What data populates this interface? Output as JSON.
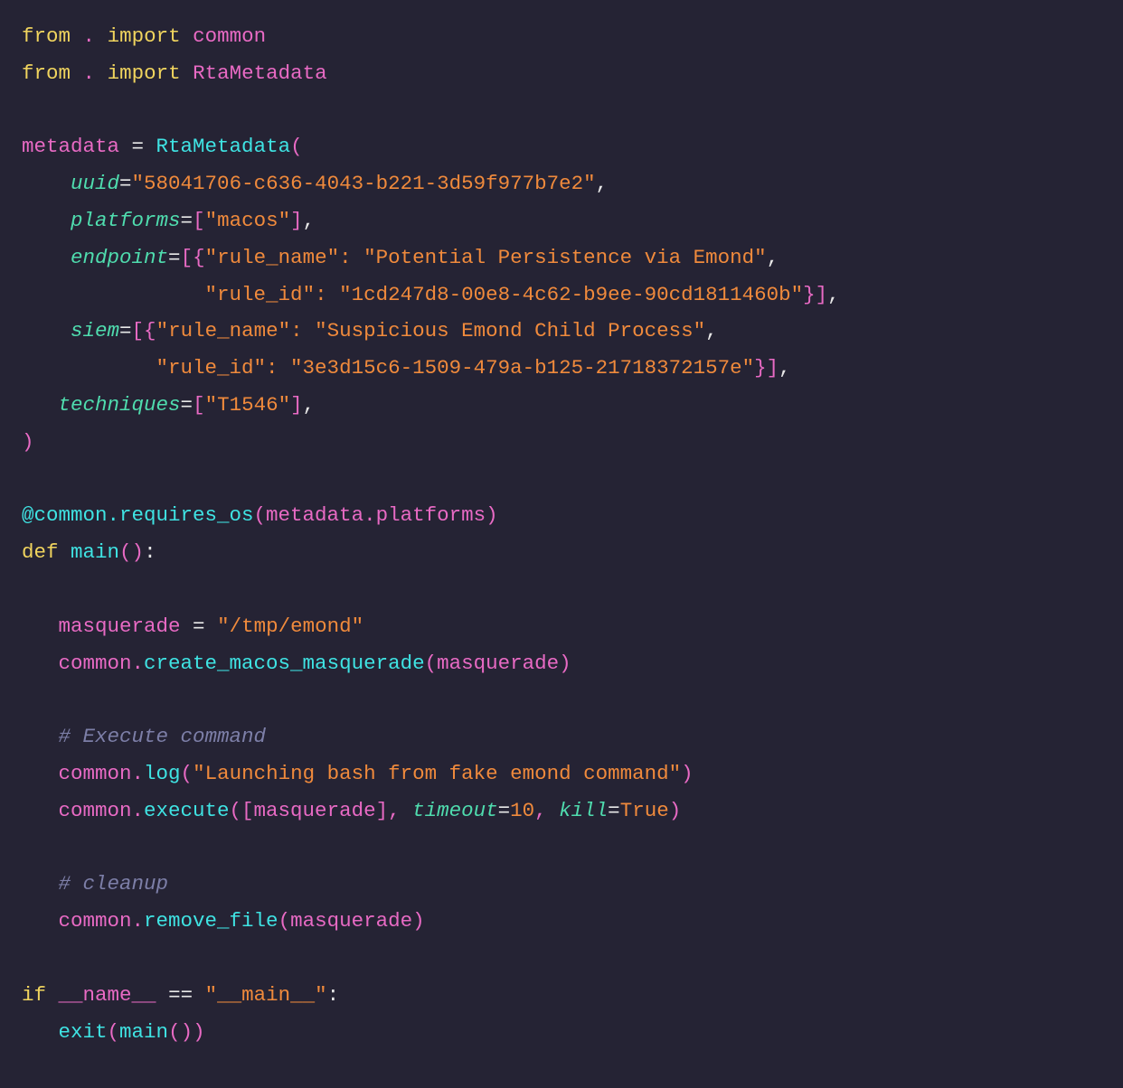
{
  "editor": {
    "language": "python",
    "colors": {
      "background": "#252334",
      "keyword": "#f0d45e",
      "identifier": "#e86ac4",
      "function": "#3fe3e3",
      "string": "#f08a3c",
      "kwarg": "#4fdcae",
      "comment": "#7d7fa8"
    },
    "lines": [
      [
        [
          "kw",
          "from"
        ],
        [
          "wh",
          " "
        ],
        [
          "pk",
          "."
        ],
        [
          "wh",
          " "
        ],
        [
          "kw",
          "import"
        ],
        [
          "wh",
          " "
        ],
        [
          "pk",
          "common"
        ]
      ],
      [
        [
          "kw",
          "from"
        ],
        [
          "wh",
          " "
        ],
        [
          "pk",
          "."
        ],
        [
          "wh",
          " "
        ],
        [
          "kw",
          "import"
        ],
        [
          "wh",
          " "
        ],
        [
          "pk",
          "RtaMetadata"
        ]
      ],
      [],
      [
        [
          "pk",
          "metadata"
        ],
        [
          "wh",
          " = "
        ],
        [
          "cy",
          "RtaMetadata"
        ],
        [
          "pk",
          "("
        ]
      ],
      [
        [
          "wh",
          "    "
        ],
        [
          "gr",
          "uuid"
        ],
        [
          "wh",
          "="
        ],
        [
          "or",
          "\"58041706-c636-4043-b221-3d59f977b7e2\""
        ],
        [
          "wh",
          ","
        ]
      ],
      [
        [
          "wh",
          "    "
        ],
        [
          "gr",
          "platforms"
        ],
        [
          "wh",
          "="
        ],
        [
          "pk",
          "["
        ],
        [
          "or",
          "\"macos\""
        ],
        [
          "pk",
          "]"
        ],
        [
          "wh",
          ","
        ]
      ],
      [
        [
          "wh",
          "    "
        ],
        [
          "gr",
          "endpoint"
        ],
        [
          "wh",
          "="
        ],
        [
          "pk",
          "[{"
        ],
        [
          "or",
          "\"rule_name\": \"Potential Persistence via Emond\""
        ],
        [
          "wh",
          ","
        ]
      ],
      [
        [
          "wh",
          "               "
        ],
        [
          "or",
          "\"rule_id\": \"1cd247d8-00e8-4c62-b9ee-90cd1811460b\""
        ],
        [
          "pk",
          "}]"
        ],
        [
          "wh",
          ","
        ]
      ],
      [
        [
          "wh",
          "    "
        ],
        [
          "gr",
          "siem"
        ],
        [
          "wh",
          "="
        ],
        [
          "pk",
          "[{"
        ],
        [
          "or",
          "\"rule_name\": \"Suspicious Emond Child Process\""
        ],
        [
          "wh",
          ","
        ]
      ],
      [
        [
          "wh",
          "           "
        ],
        [
          "or",
          "\"rule_id\": \"3e3d15c6-1509-479a-b125-21718372157e\""
        ],
        [
          "pk",
          "}]"
        ],
        [
          "wh",
          ","
        ]
      ],
      [
        [
          "wh",
          "   "
        ],
        [
          "gr",
          "techniques"
        ],
        [
          "wh",
          "="
        ],
        [
          "pk",
          "["
        ],
        [
          "or",
          "\"T1546\""
        ],
        [
          "pk",
          "]"
        ],
        [
          "wh",
          ","
        ]
      ],
      [
        [
          "pk",
          ")"
        ]
      ],
      [],
      [
        [
          "cy",
          "@common.requires_os"
        ],
        [
          "pk",
          "(metadata.platforms)"
        ]
      ],
      [
        [
          "kw",
          "def"
        ],
        [
          "wh",
          " "
        ],
        [
          "cy",
          "main"
        ],
        [
          "pk",
          "()"
        ],
        [
          "wh",
          ":"
        ]
      ],
      [],
      [
        [
          "wh",
          "   "
        ],
        [
          "pk",
          "masquerade"
        ],
        [
          "wh",
          " = "
        ],
        [
          "or",
          "\"/tmp/emond\""
        ]
      ],
      [
        [
          "wh",
          "   "
        ],
        [
          "pk",
          "common."
        ],
        [
          "cy",
          "create_macos_masquerade"
        ],
        [
          "pk",
          "(masquerade)"
        ]
      ],
      [],
      [
        [
          "wh",
          "   "
        ],
        [
          "cm",
          "# Execute command"
        ]
      ],
      [
        [
          "wh",
          "   "
        ],
        [
          "pk",
          "common."
        ],
        [
          "cy",
          "log"
        ],
        [
          "pk",
          "("
        ],
        [
          "or",
          "\"Launching bash from fake emond command\""
        ],
        [
          "pk",
          ")"
        ]
      ],
      [
        [
          "wh",
          "   "
        ],
        [
          "pk",
          "common."
        ],
        [
          "cy",
          "execute"
        ],
        [
          "pk",
          "([masquerade], "
        ],
        [
          "gr",
          "timeout"
        ],
        [
          "wh",
          "="
        ],
        [
          "or",
          "10"
        ],
        [
          "pk",
          ", "
        ],
        [
          "gr",
          "kill"
        ],
        [
          "wh",
          "="
        ],
        [
          "or",
          "True"
        ],
        [
          "pk",
          ")"
        ]
      ],
      [],
      [
        [
          "wh",
          "   "
        ],
        [
          "cm",
          "# cleanup"
        ]
      ],
      [
        [
          "wh",
          "   "
        ],
        [
          "pk",
          "common."
        ],
        [
          "cy",
          "remove_file"
        ],
        [
          "pk",
          "(masquerade)"
        ]
      ],
      [],
      [
        [
          "kw",
          "if"
        ],
        [
          "wh",
          " "
        ],
        [
          "pk",
          "__name__"
        ],
        [
          "wh",
          " == "
        ],
        [
          "or",
          "\"__main__\""
        ],
        [
          "wh",
          ":"
        ]
      ],
      [
        [
          "wh",
          "   "
        ],
        [
          "cy",
          "exit"
        ],
        [
          "pk",
          "("
        ],
        [
          "cy",
          "main"
        ],
        [
          "pk",
          "())"
        ]
      ]
    ]
  }
}
